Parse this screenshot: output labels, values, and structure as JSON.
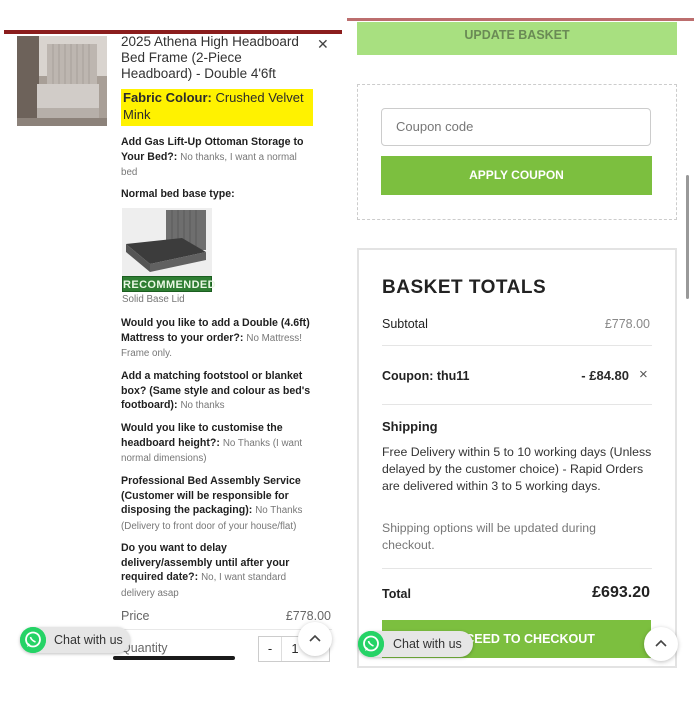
{
  "left": {
    "product_title": "2025 Athena High Headboard Bed Frame (2-Piece Headboard) - Double 4'6ft",
    "close_icon": "close-icon",
    "fabric_label": "Fabric Colour:",
    "fabric_value": "Crushed Velvet Mink",
    "options": [
      {
        "q": "Add Gas Lift-Up Ottoman Storage to Your Bed?:",
        "a": "No thanks, I want a normal bed"
      },
      {
        "q": "Normal bed base type:",
        "a": ""
      },
      {
        "q": "Would you like to add a Double (4.6ft) Mattress to your order?:",
        "a": "No Mattress! Frame only."
      },
      {
        "q": "Add a matching footstool or blanket box? (Same style and colour as bed's footboard):",
        "a": "No thanks"
      },
      {
        "q": "Would you like to customise the headboard height?:",
        "a": "No Thanks (I want normal dimensions)"
      },
      {
        "q": "Professional Bed Assembly Service (Customer will be responsible for disposing the packaging):",
        "a": "No Thanks (Delivery to front door of your house/flat)"
      },
      {
        "q": "Do you want to delay delivery/assembly until after your required date?:",
        "a": "No, I want standard delivery asap"
      }
    ],
    "recommended_badge": "RECOMMENDED",
    "base_caption": "Solid Base Lid",
    "price_label": "Price",
    "price_value": "£778.00",
    "quantity_label": "Quantity",
    "quantity_value": "1",
    "minus": "-",
    "chat_label": "Chat with us"
  },
  "right": {
    "update_basket": "UPDATE BASKET",
    "coupon_placeholder": "Coupon code",
    "apply_coupon": "APPLY COUPON",
    "totals_title": "BASKET TOTALS",
    "subtotal_label": "Subtotal",
    "subtotal_value": "£778.00",
    "coupon_label": "Coupon: thu11",
    "coupon_value": "- £84.80",
    "coupon_remove": "×",
    "shipping_label": "Shipping",
    "shipping_text": "Free Delivery within 5 to 10 working days (Unless delayed by the customer choice) - Rapid Orders are delivered within 3 to 5 working days.",
    "shipping_note": "Shipping options will be updated during checkout.",
    "total_label": "Total",
    "total_value": "£693.20",
    "checkout_label": "PROCEED TO CHECKOUT",
    "chat_label": "Chat with us"
  },
  "colors": {
    "green": "#7cbf3f",
    "light_green": "#a8e080",
    "highlight": "#fff200",
    "whatsapp": "#25d366"
  }
}
